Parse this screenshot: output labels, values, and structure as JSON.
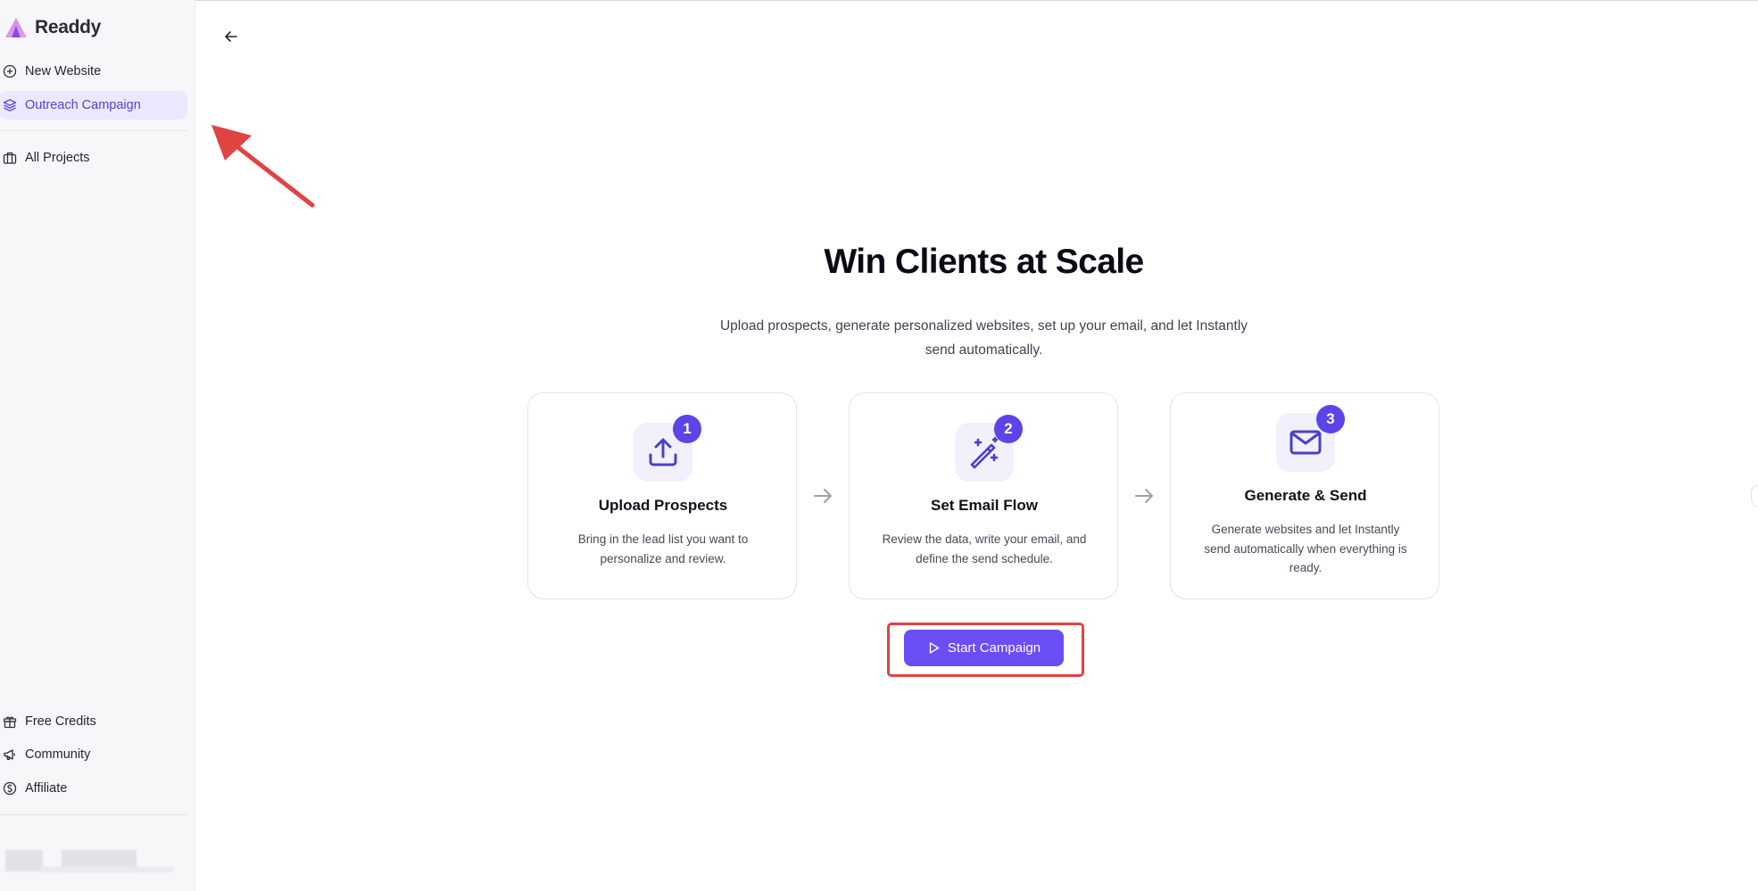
{
  "app": {
    "name": "Readdy"
  },
  "sidebar": {
    "items": [
      {
        "label": "New Website",
        "icon": "plus-circle-icon"
      },
      {
        "label": "Outreach Campaign",
        "icon": "layers-icon",
        "active": true
      },
      {
        "label": "All Projects",
        "icon": "briefcase-icon"
      }
    ],
    "footer_items": [
      {
        "label": "Free Credits",
        "icon": "gift-icon"
      },
      {
        "label": "Community",
        "icon": "megaphone-icon"
      },
      {
        "label": "Affiliate",
        "icon": "dollar-circle-icon"
      }
    ]
  },
  "main": {
    "title": "Win Clients at Scale",
    "subtitle_line1": "Upload prospects, generate personalized websites, set up your email, and let Instantly",
    "subtitle_line2": "send automatically.",
    "steps": [
      {
        "number": "1",
        "title": "Upload Prospects",
        "description": "Bring in the lead list you want to personalize and review.",
        "icon": "upload-icon"
      },
      {
        "number": "2",
        "title": "Set Email Flow",
        "description": "Review the data, write your email, and define the send schedule.",
        "icon": "magic-wand-icon"
      },
      {
        "number": "3",
        "title": "Generate & Send",
        "description": "Generate websites and let Instantly send automatically when everything is ready.",
        "icon": "mail-icon"
      }
    ],
    "cta_label": "Start Campaign"
  },
  "colors": {
    "accent": "#6b4ef5",
    "badge": "#5b45e8",
    "active_bg": "#ece8fd",
    "annotation": "#e14242"
  }
}
